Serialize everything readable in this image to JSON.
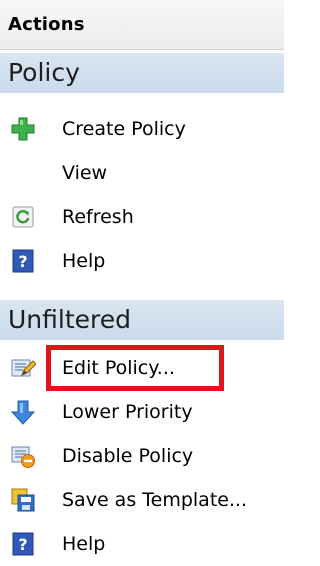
{
  "header": {
    "title": "Actions"
  },
  "groups": [
    {
      "title": "Policy",
      "items": [
        {
          "label": "Create Policy",
          "icon": "add-icon"
        },
        {
          "label": "View",
          "icon": ""
        },
        {
          "label": "Refresh",
          "icon": "refresh-icon"
        },
        {
          "label": "Help",
          "icon": "help-icon"
        }
      ]
    },
    {
      "title": "Unfiltered",
      "items": [
        {
          "label": "Edit Policy...",
          "icon": "edit-icon"
        },
        {
          "label": "Lower Priority",
          "icon": "arrow-down-icon"
        },
        {
          "label": "Disable Policy",
          "icon": "disable-icon"
        },
        {
          "label": "Save as Template...",
          "icon": "save-template-icon"
        },
        {
          "label": "Help",
          "icon": "help-icon"
        }
      ]
    }
  ],
  "annotation": {
    "color": "#e3131d"
  }
}
